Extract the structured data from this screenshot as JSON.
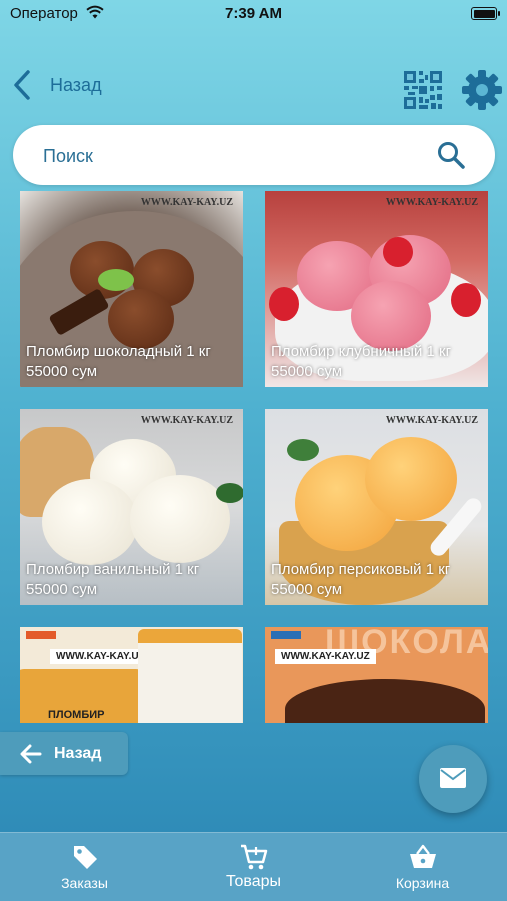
{
  "status_bar": {
    "carrier": "Оператор",
    "time": "7:39 AM"
  },
  "header": {
    "back_label": "Назад",
    "qr_icon": "qr-code-icon",
    "settings_icon": "gear-icon"
  },
  "search": {
    "placeholder": "Поиск"
  },
  "watermark": "WWW.KAY-KAY.UZ",
  "products": [
    {
      "name": "Пломбир шоколадный 1 кг",
      "price": "55000 сум"
    },
    {
      "name": "Пломбир клубничный 1 кг",
      "price": "55000 сум"
    },
    {
      "name": "Пломбир ванильный 1 кг",
      "price": "55000 сум"
    },
    {
      "name": "Пломбир персиковый 1 кг",
      "price": "55000 сум"
    },
    {
      "name": "",
      "price": ""
    },
    {
      "name": "",
      "price": ""
    }
  ],
  "package_text": {
    "brand_label": "WWW.KAY-KAY.UZ",
    "product_word": "ПЛОМБИР",
    "bg_word": "ШОКОЛАД"
  },
  "back_button": {
    "label": "Назад"
  },
  "fab": {
    "icon": "mail-icon"
  },
  "tabbar": {
    "tabs": [
      {
        "label": "Заказы",
        "icon": "tag-icon"
      },
      {
        "label": "Товары",
        "icon": "cart-icon",
        "active": true
      },
      {
        "label": "Корзина",
        "icon": "basket-icon"
      }
    ]
  },
  "colors": {
    "accent": "#4e9cbb",
    "text_blue": "#1d6d99"
  }
}
